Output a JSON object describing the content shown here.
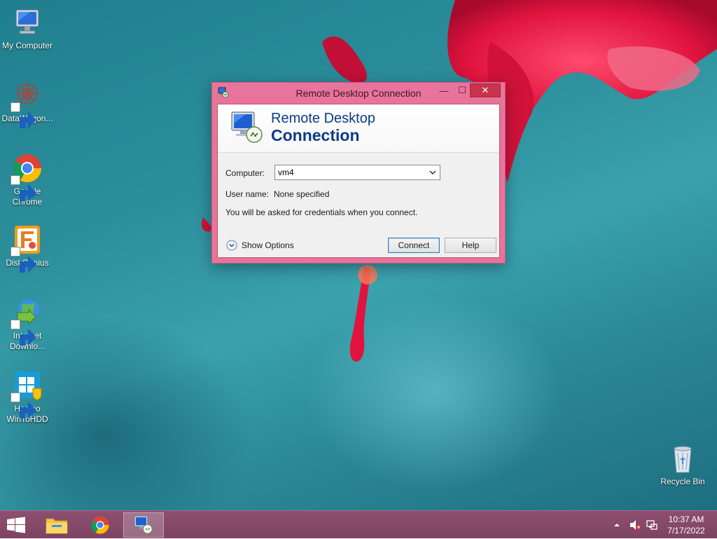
{
  "desktop": {
    "icons": [
      {
        "label": "My Computer",
        "icon": "computer-icon"
      },
      {
        "label": "DataWagon...",
        "icon": "datawagon-icon"
      },
      {
        "label": "Google Chrome",
        "icon": "chrome-icon"
      },
      {
        "label": "DiskGenius",
        "icon": "diskgenius-icon"
      },
      {
        "label": "Internet Downlo...",
        "icon": "internet-download-manager-icon"
      },
      {
        "label": "Hasleo WinToHDD",
        "icon": "hasleo-wintohdd-icon"
      },
      {
        "label": "Recycle Bin",
        "icon": "recycle-bin-icon"
      }
    ]
  },
  "dialog": {
    "title": "Remote Desktop Connection",
    "banner_line1": "Remote Desktop",
    "banner_line2": "Connection",
    "computer_label": "Computer:",
    "computer_value": "vm4",
    "username_label": "User name:",
    "username_value": "None specified",
    "info_text": "You will be asked for credentials when you connect.",
    "show_options_label": "Show Options",
    "connect_label": "Connect",
    "help_label": "Help",
    "minimize_glyph": "—",
    "maximize_glyph": "☐",
    "close_glyph": "✕"
  },
  "taskbar": {
    "items": [
      {
        "name": "file-explorer",
        "active": false
      },
      {
        "name": "google-chrome",
        "active": false
      },
      {
        "name": "remote-desktop-connection",
        "active": true
      }
    ],
    "time": "10:37 AM",
    "date": "7/17/2022"
  },
  "colors": {
    "accent": "#e9749b",
    "taskbar": "#8e4f70",
    "close_button": "#c7344b",
    "banner_text": "#0c3b86",
    "desktop_bg": "#2d8f9c"
  }
}
